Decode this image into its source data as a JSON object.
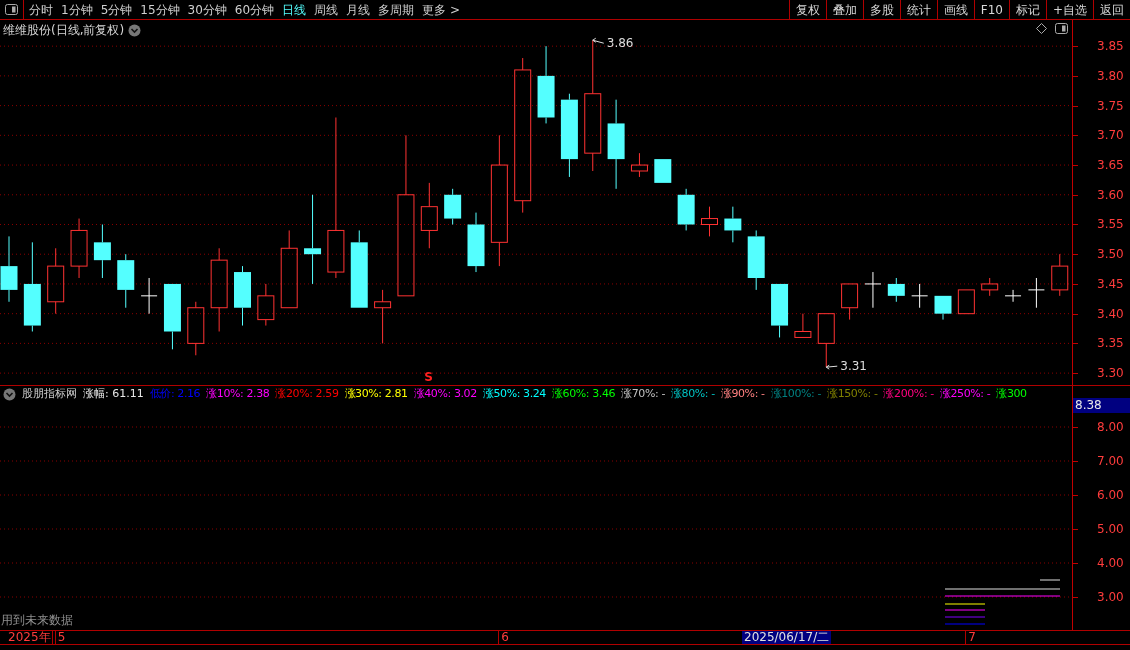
{
  "toolbar": {
    "periods": [
      {
        "label": "分时",
        "selected": false
      },
      {
        "label": "1分钟",
        "selected": false
      },
      {
        "label": "5分钟",
        "selected": false
      },
      {
        "label": "15分钟",
        "selected": false
      },
      {
        "label": "30分钟",
        "selected": false
      },
      {
        "label": "60分钟",
        "selected": false
      },
      {
        "label": "日线",
        "selected": true
      },
      {
        "label": "周线",
        "selected": false
      },
      {
        "label": "月线",
        "selected": false
      },
      {
        "label": "多周期",
        "selected": false
      },
      {
        "label": "更多 >",
        "selected": false
      }
    ],
    "actions": [
      "复权",
      "叠加",
      "多股",
      "统计",
      "画线",
      "F10",
      "标记",
      "+自选",
      "返回"
    ]
  },
  "price_chart": {
    "title": "维维股份(日线,前复权)",
    "signal_marker": "S",
    "high_label": "3.86",
    "low_label": "3.31",
    "axis_labels": [
      "3.85",
      "3.80",
      "3.75",
      "3.70",
      "3.65",
      "3.60",
      "3.55",
      "3.50",
      "3.45",
      "3.40",
      "3.35",
      "3.30"
    ]
  },
  "indicator": {
    "name": "股朋指标网",
    "main": "涨幅: 61.11",
    "values": [
      {
        "label": "低价: 2.16",
        "color": "#0000ff"
      },
      {
        "label": "涨10%: 2.38",
        "color": "#ff00ff"
      },
      {
        "label": "涨20%: 2.59",
        "color": "#ff0000"
      },
      {
        "label": "涨30%: 2.81",
        "color": "#ffff00"
      },
      {
        "label": "涨40%: 3.02",
        "color": "#ff00ff"
      },
      {
        "label": "涨50%: 3.24",
        "color": "#00ffff"
      },
      {
        "label": "涨60%: 3.46",
        "color": "#00ff00"
      },
      {
        "label": "涨70%: -",
        "color": "#c0c0c0"
      },
      {
        "label": "涨80%: -",
        "color": "#00c0c0"
      },
      {
        "label": "涨90%: -",
        "color": "#ff8080"
      },
      {
        "label": "涨100%: -",
        "color": "#008080"
      },
      {
        "label": "涨150%: -",
        "color": "#808000"
      },
      {
        "label": "涨200%: -",
        "color": "#ff0080"
      },
      {
        "label": "涨250%: -",
        "color": "#ff00ff"
      },
      {
        "label": "涨300",
        "color": "#00ff00"
      }
    ],
    "current_value": "8.38",
    "axis_labels": [
      "8.00",
      "7.00",
      "6.00",
      "5.00",
      "4.00",
      "3.00"
    ],
    "note": "用到未来数据"
  },
  "time_axis": {
    "year": "2025年",
    "months": [
      "5",
      "6",
      "7"
    ],
    "cursor_date": "2025/06/17/二"
  }
}
